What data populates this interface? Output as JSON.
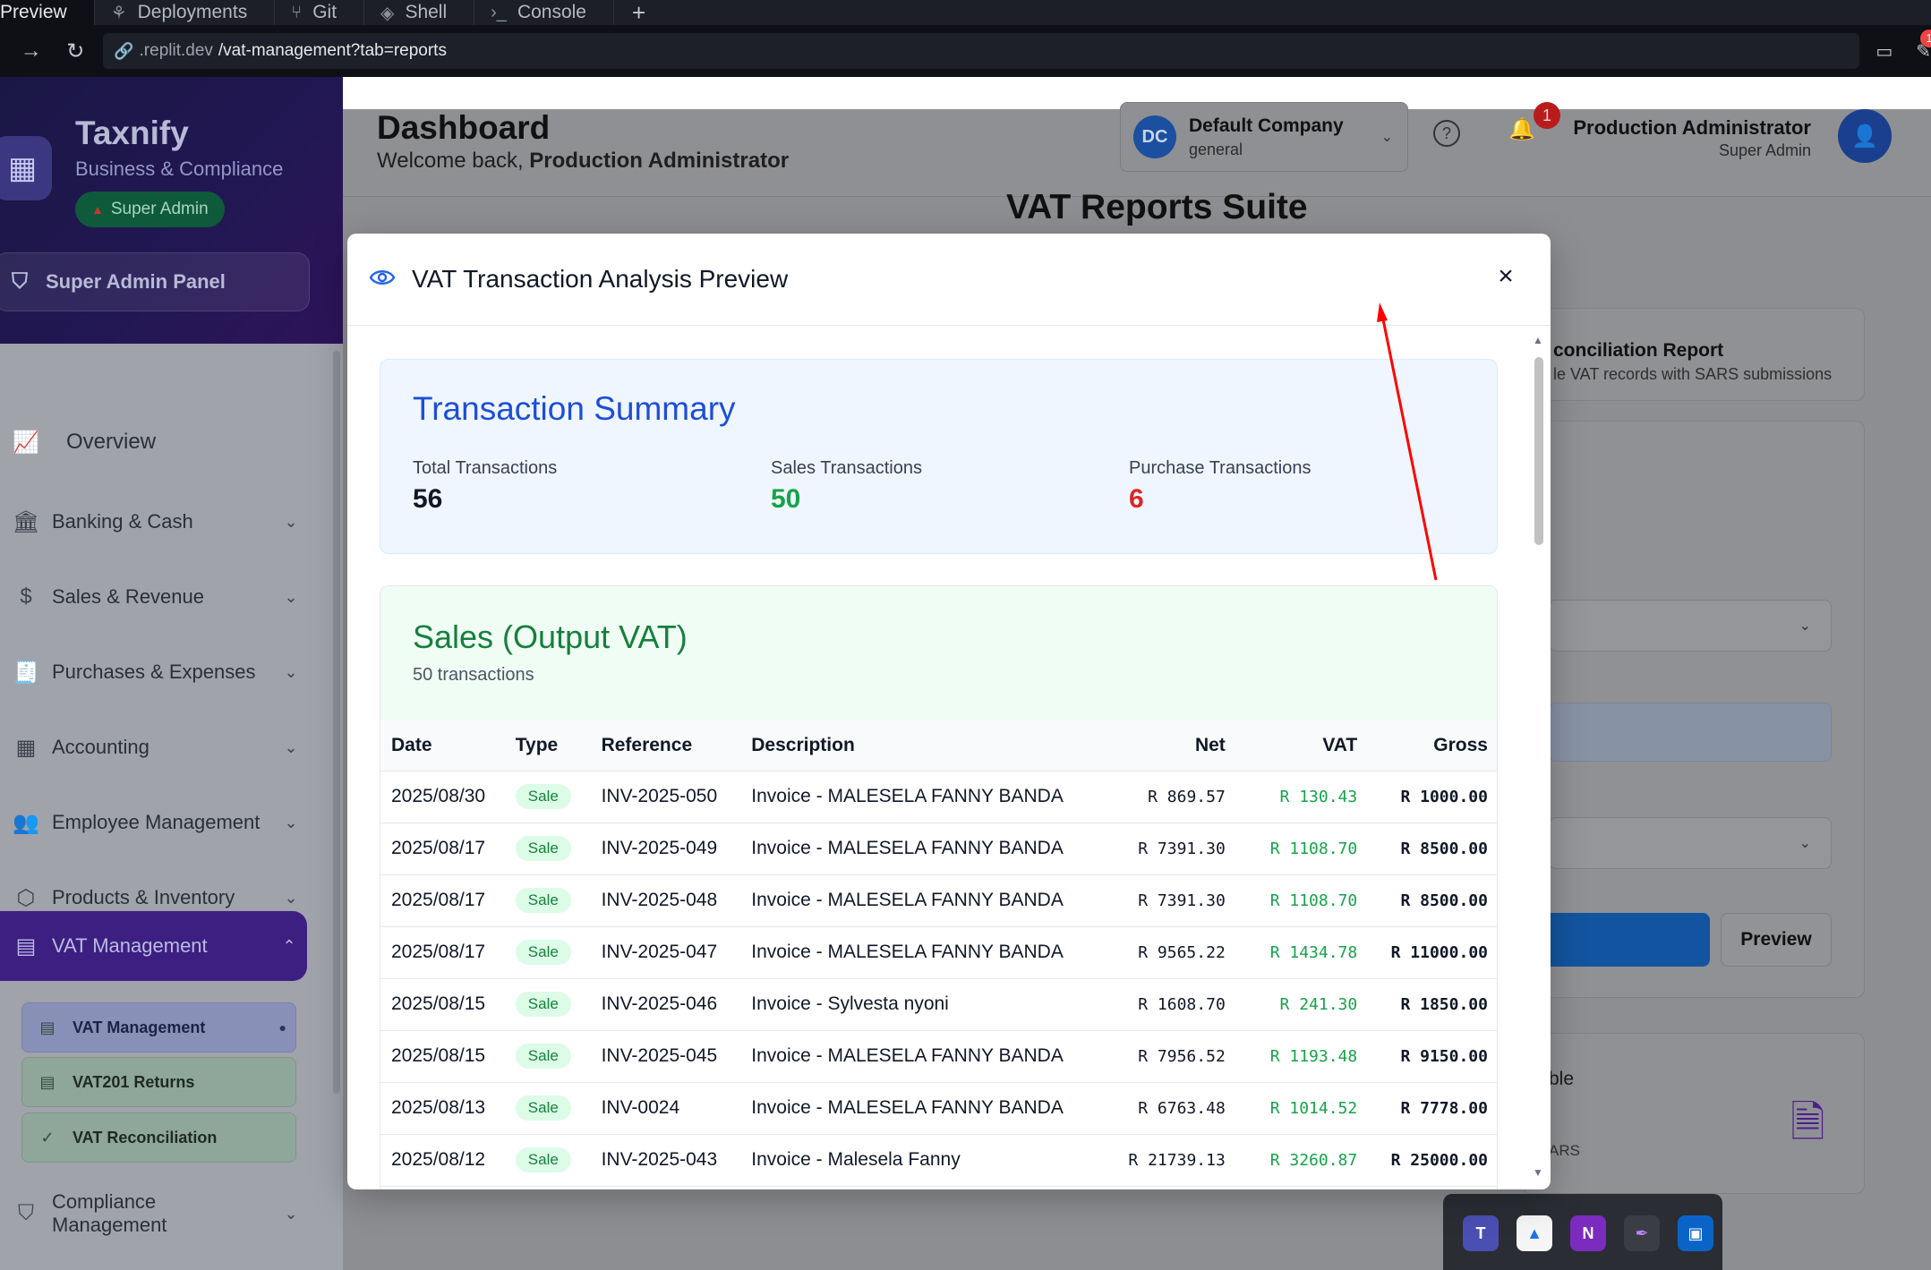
{
  "browser": {
    "tabs": [
      {
        "label": "Preview",
        "icon": "preview-icon"
      },
      {
        "label": "Deployments",
        "icon": "deploy-icon"
      },
      {
        "label": "Git",
        "icon": "git-icon"
      },
      {
        "label": "Shell",
        "icon": "shell-icon"
      },
      {
        "label": "Console",
        "icon": "console-icon"
      }
    ],
    "new_tab": "+",
    "url_host": ".replit.dev",
    "url_path": "/vat-management?tab=reports",
    "notif_count": "1"
  },
  "sidebar": {
    "brand": "Taxnify",
    "tagline": "Business & Compliance",
    "role_badge": "Super Admin",
    "admin_panel": "Super Admin Panel",
    "items": [
      {
        "label": "Overview"
      },
      {
        "label": "Banking & Cash"
      },
      {
        "label": "Sales & Revenue"
      },
      {
        "label": "Purchases & Expenses"
      },
      {
        "label": "Accounting"
      },
      {
        "label": "Employee Management"
      },
      {
        "label": "Products & Inventory"
      },
      {
        "label": "VAT Management"
      },
      {
        "label": "Compliance Management"
      }
    ],
    "sub_items": [
      {
        "label": "VAT Management"
      },
      {
        "label": "VAT201 Returns"
      },
      {
        "label": "VAT Reconciliation"
      }
    ]
  },
  "header": {
    "title": "Dashboard",
    "welcome_prefix": "Welcome back,",
    "welcome_name": "Production Administrator",
    "company_initials": "DC",
    "company_name": "Default Company",
    "company_type": "general",
    "notif_count": "1",
    "user_name": "Production Administrator",
    "user_role": "Super Admin"
  },
  "page": {
    "suite_title": "VAT Reports Suite",
    "card_title_fragment": "conciliation Report",
    "card_sub_fragment": "le VAT records with SARS submissions",
    "preview_button": "Preview",
    "frag_1": "ble",
    "frag_2": "ARS"
  },
  "modal": {
    "title": "VAT Transaction Analysis Preview",
    "close": "×",
    "summary": {
      "heading": "Transaction Summary",
      "total_label": "Total Transactions",
      "total_value": "56",
      "sales_label": "Sales Transactions",
      "sales_value": "50",
      "purchase_label": "Purchase Transactions",
      "purchase_value": "6"
    },
    "sales": {
      "heading": "Sales (Output VAT)",
      "count": "50 transactions",
      "columns": [
        "Date",
        "Type",
        "Reference",
        "Description",
        "Net",
        "VAT",
        "Gross"
      ],
      "rows": [
        {
          "date": "2025/08/30",
          "type": "Sale",
          "ref": "INV-2025-050",
          "desc": "Invoice - MALESELA FANNY BANDA",
          "net": "R 869.57",
          "vat": "R 130.43",
          "gross": "R 1000.00"
        },
        {
          "date": "2025/08/17",
          "type": "Sale",
          "ref": "INV-2025-049",
          "desc": "Invoice - MALESELA FANNY BANDA",
          "net": "R 7391.30",
          "vat": "R 1108.70",
          "gross": "R 8500.00"
        },
        {
          "date": "2025/08/17",
          "type": "Sale",
          "ref": "INV-2025-048",
          "desc": "Invoice - MALESELA FANNY BANDA",
          "net": "R 7391.30",
          "vat": "R 1108.70",
          "gross": "R 8500.00"
        },
        {
          "date": "2025/08/17",
          "type": "Sale",
          "ref": "INV-2025-047",
          "desc": "Invoice - MALESELA FANNY BANDA",
          "net": "R 9565.22",
          "vat": "R 1434.78",
          "gross": "R 11000.00"
        },
        {
          "date": "2025/08/15",
          "type": "Sale",
          "ref": "INV-2025-046",
          "desc": "Invoice - Sylvesta nyoni",
          "net": "R 1608.70",
          "vat": "R 241.30",
          "gross": "R 1850.00"
        },
        {
          "date": "2025/08/15",
          "type": "Sale",
          "ref": "INV-2025-045",
          "desc": "Invoice - MALESELA FANNY BANDA",
          "net": "R 7956.52",
          "vat": "R 1193.48",
          "gross": "R 9150.00"
        },
        {
          "date": "2025/08/13",
          "type": "Sale",
          "ref": "INV-0024",
          "desc": "Invoice - MALESELA FANNY BANDA",
          "net": "R 6763.48",
          "vat": "R 1014.52",
          "gross": "R 7778.00"
        },
        {
          "date": "2025/08/12",
          "type": "Sale",
          "ref": "INV-2025-043",
          "desc": "Invoice - Malesela Fanny",
          "net": "R 21739.13",
          "vat": "R 3260.87",
          "gross": "R 25000.00"
        }
      ]
    }
  },
  "colors": {
    "accent_blue": "#1d4ed8",
    "sales_green": "#16a34a",
    "purchase_red": "#dc2626",
    "annotation_arrow": "#ff0000"
  }
}
